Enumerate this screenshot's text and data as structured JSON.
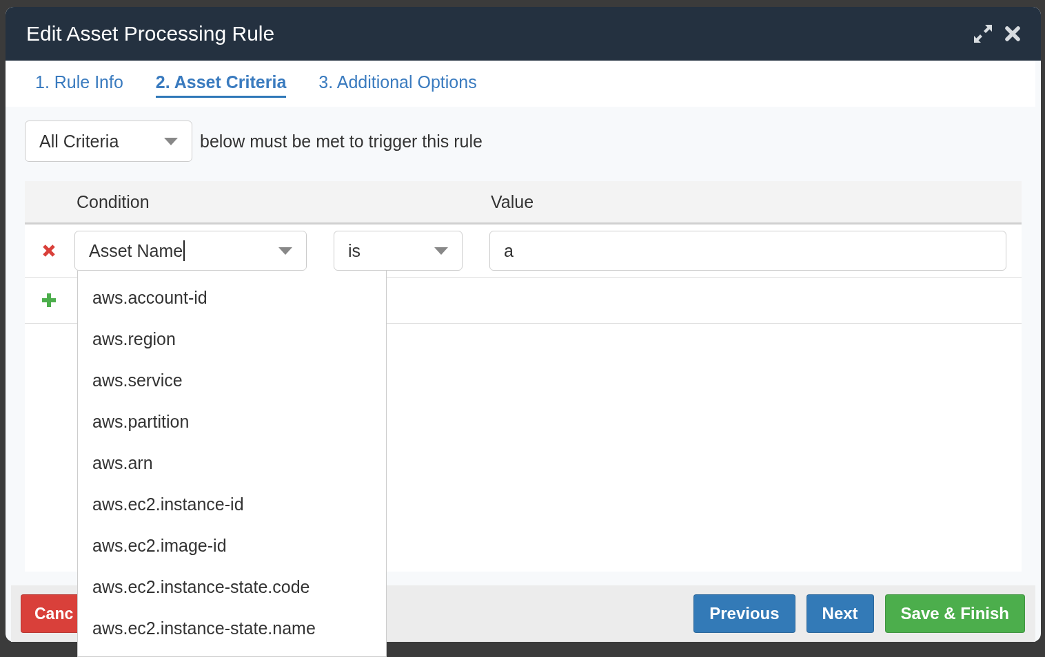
{
  "dialog": {
    "title": "Edit Asset Processing Rule"
  },
  "tabs": [
    {
      "label": "1. Rule Info",
      "selected": false
    },
    {
      "label": "2. Asset Criteria",
      "selected": true
    },
    {
      "label": "3. Additional Options",
      "selected": false
    }
  ],
  "match": {
    "value": "All Criteria",
    "text": "below must be met to trigger this rule"
  },
  "table": {
    "columns": [
      "Condition",
      "Value"
    ],
    "rows": [
      {
        "field": "Asset Name",
        "focused": true,
        "operator": "is",
        "value": "a"
      }
    ]
  },
  "field_dropdown": {
    "options": [
      "aws.account-id",
      "aws.region",
      "aws.service",
      "aws.partition",
      "aws.arn",
      "aws.ec2.instance-id",
      "aws.ec2.image-id",
      "aws.ec2.instance-state.code",
      "aws.ec2.instance-state.name"
    ]
  },
  "buttons": [
    {
      "label": "Canc",
      "kind": "danger"
    },
    {
      "label": "Previous",
      "kind": "primary"
    },
    {
      "label": "Next",
      "kind": "primary"
    },
    {
      "label": "Save & Finish",
      "kind": "success"
    }
  ]
}
